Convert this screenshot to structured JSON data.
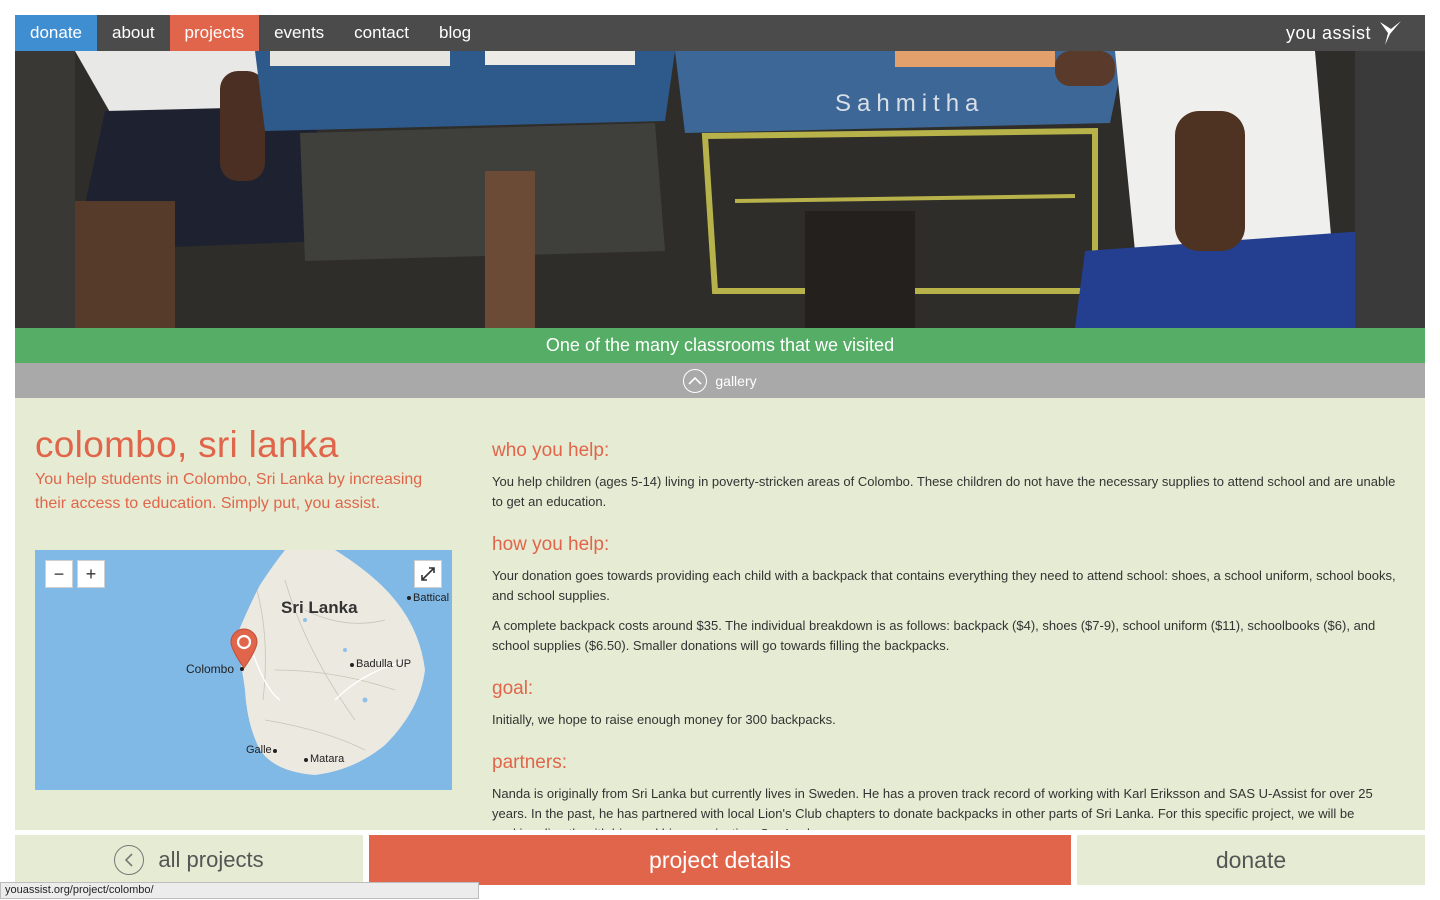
{
  "nav": {
    "items": [
      {
        "label": "donate"
      },
      {
        "label": "about"
      },
      {
        "label": "projects"
      },
      {
        "label": "events"
      },
      {
        "label": "contact"
      },
      {
        "label": "blog"
      }
    ],
    "active": "projects",
    "brand": "you assist"
  },
  "hero": {
    "caption": "One of the many classrooms that we visited",
    "gallery_label": "gallery",
    "desk_writing": "Sahmitha"
  },
  "project": {
    "title": "colombo, sri lanka",
    "lede": "You help students in Colombo, Sri Lanka by increasing their access to education. Simply put, you assist."
  },
  "map": {
    "zoom_out": "−",
    "zoom_in": "+",
    "labels": {
      "country": "Sri Lanka",
      "colombo": "Colombo",
      "batticaloa": "Battical",
      "badulla": "Badulla UP",
      "galle": "Galle",
      "matara": "Matara"
    }
  },
  "sections": [
    {
      "heading": "who you help:",
      "paragraphs": [
        "You help children (ages 5-14) living in poverty-stricken areas of Colombo. These children do not have the necessary supplies to attend school and are unable to get an education."
      ]
    },
    {
      "heading": "how you help:",
      "paragraphs": [
        "Your donation goes towards providing each child with a backpack that contains everything they need to attend school: shoes, a school uniform, school books, and school supplies.",
        "A complete backpack costs around $35. The individual breakdown is as follows: backpack ($4), shoes ($7-9), school uniform ($11), schoolbooks ($6), and school supplies ($6.50). Smaller donations will go towards filling the backpacks."
      ]
    },
    {
      "heading": "goal:",
      "paragraphs": [
        "Initially, we hope to raise enough money for 300 backpacks."
      ]
    },
    {
      "heading": "partners:",
      "paragraphs": [
        "Nanda is originally from Sri Lanka but currently lives in Sweden. He has a proven track record of working with Karl Eriksson and SAS U-Assist for over 25 years. In the past, he has partnered with local Lion's Club chapters to donate backpacks in other parts of Sri Lanka. For this specific project, we will be working directly with him and his organization, SweLanka."
      ]
    }
  ],
  "bottom": {
    "all_projects": "all projects",
    "project_details": "project details",
    "donate": "donate"
  },
  "status_url": "youassist.org/project/colombo/",
  "colors": {
    "accent": "#e0654a",
    "donate_blue": "#3f8ed2",
    "nav_bg": "#4b4b4b",
    "caption_green": "#55ad66",
    "content_bg": "#e5ecd3"
  }
}
